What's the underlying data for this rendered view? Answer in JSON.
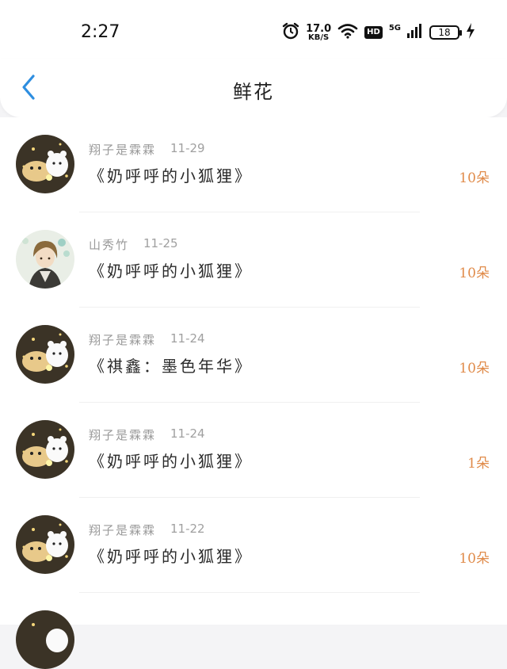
{
  "status_bar": {
    "time": "2:27",
    "net_speed_value": "17.0",
    "net_speed_unit": "KB/S",
    "hd_badge": "HD",
    "network_type": "5G",
    "battery_level": "18",
    "icons": [
      "alarm-icon",
      "wifi-icon",
      "signal-icon",
      "battery-icon",
      "charging-icon"
    ]
  },
  "header": {
    "title": "鲜花",
    "back_icon": "chevron-left-icon",
    "accent_color": "#2e8ee0"
  },
  "colors": {
    "count": "#e08b4a",
    "meta": "#9a9a9a"
  },
  "records": [
    {
      "user": "翔子是霖霖",
      "date": "11-29",
      "book": "《奶呼呼的小狐狸》",
      "count": "10朵",
      "avatar": "bear-cartoon-avatar"
    },
    {
      "user": "山秀竹",
      "date": "11-25",
      "book": "《奶呼呼的小狐狸》",
      "count": "10朵",
      "avatar": "anime-boy-avatar"
    },
    {
      "user": "翔子是霖霖",
      "date": "11-24",
      "book": "《祺鑫：墨色年华》",
      "count": "10朵",
      "avatar": "bear-cartoon-avatar"
    },
    {
      "user": "翔子是霖霖",
      "date": "11-24",
      "book": "《奶呼呼的小狐狸》",
      "count": "1朵",
      "avatar": "bear-cartoon-avatar"
    },
    {
      "user": "翔子是霖霖",
      "date": "11-22",
      "book": "《奶呼呼的小狐狸》",
      "count": "10朵",
      "avatar": "bear-cartoon-avatar"
    }
  ]
}
